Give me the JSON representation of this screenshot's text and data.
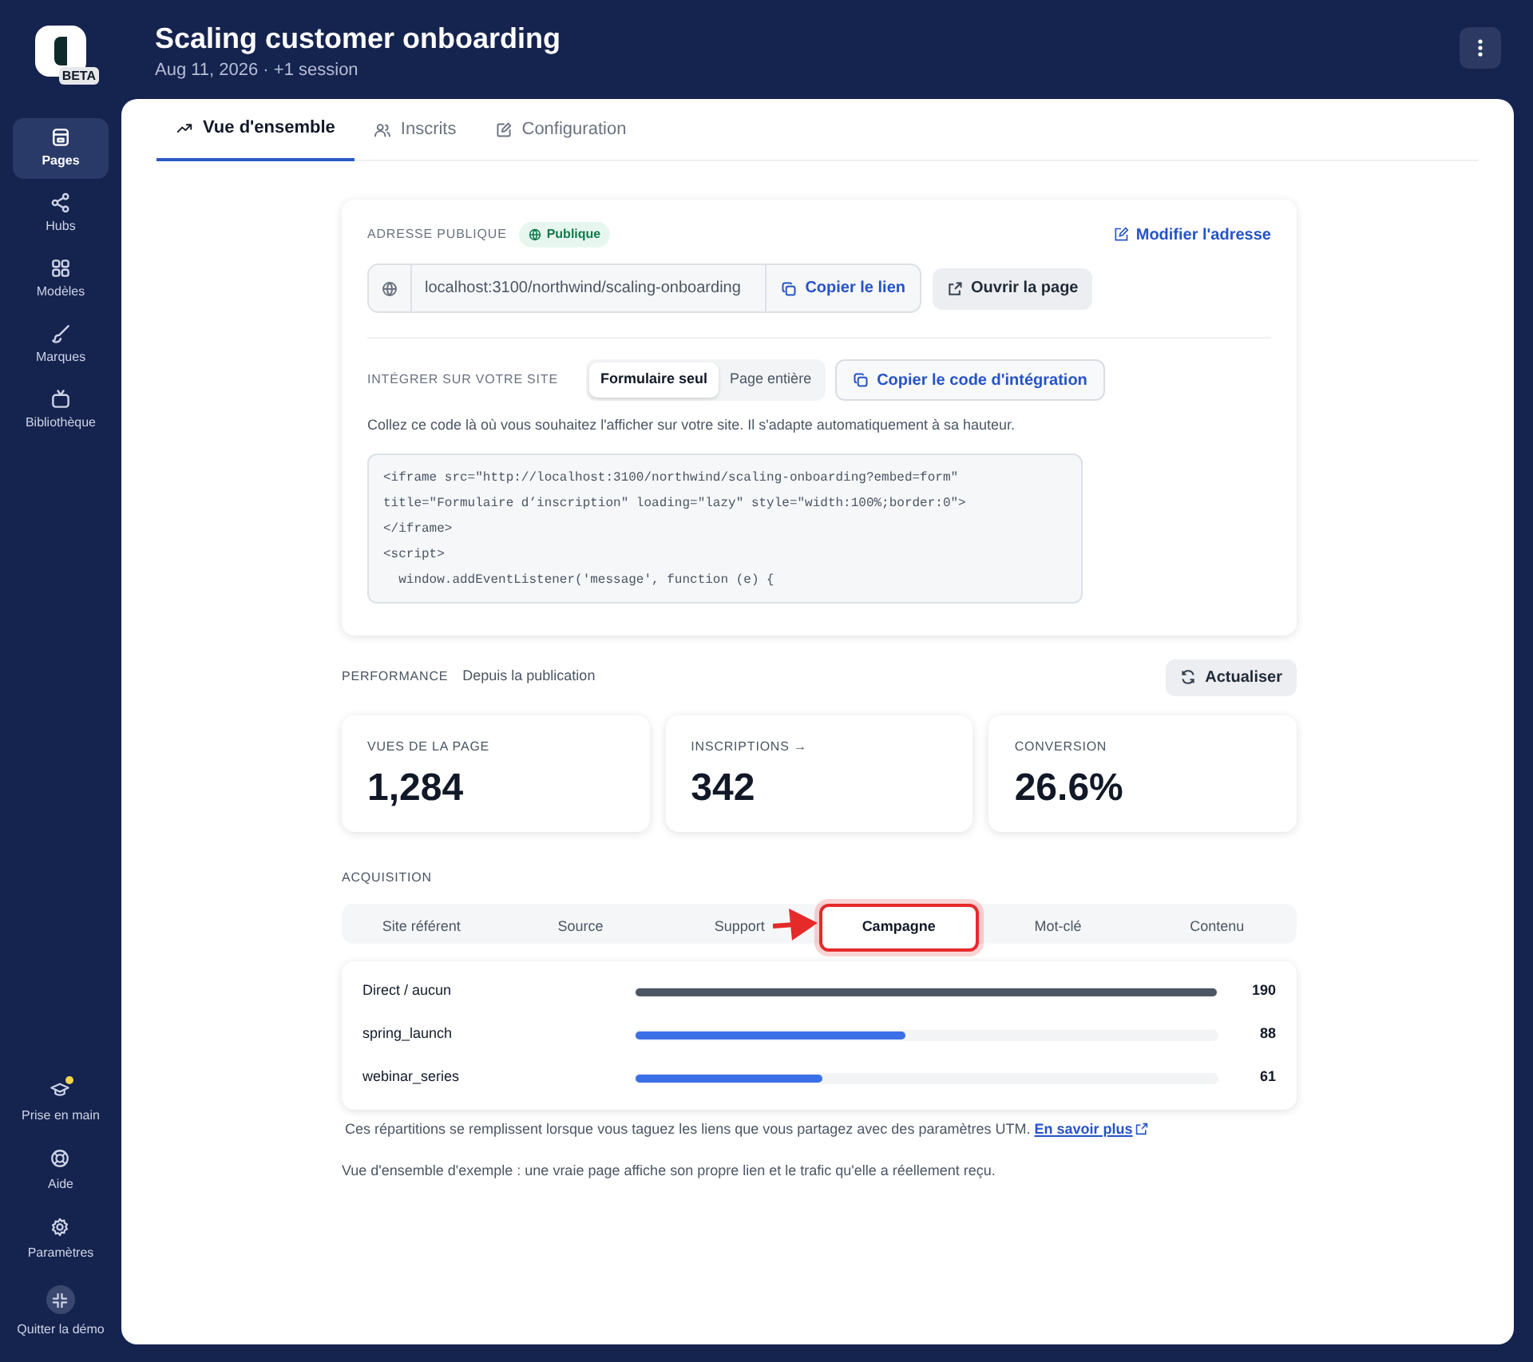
{
  "sidebar": {
    "logo_badge": "BETA",
    "items": [
      {
        "label": "Pages",
        "selected": true
      },
      {
        "label": "Hubs",
        "selected": false
      },
      {
        "label": "Modèles",
        "selected": false
      },
      {
        "label": "Marques",
        "selected": false
      },
      {
        "label": "Bibliothèque",
        "selected": false
      }
    ],
    "bottom_items": [
      {
        "label": "Prise en main",
        "notification": true
      },
      {
        "label": "Aide",
        "notification": false
      },
      {
        "label": "Paramètres",
        "notification": false
      },
      {
        "label": "Quitter la démo",
        "notification": false
      }
    ]
  },
  "header": {
    "title": "Scaling customer onboarding",
    "subtitle": "Aug 11, 2026 · +1 session"
  },
  "tabs": [
    {
      "label": "Vue d'ensemble",
      "selected": true
    },
    {
      "label": "Inscrits",
      "selected": false
    },
    {
      "label": "Configuration",
      "selected": false
    }
  ],
  "public_address": {
    "label": "ADRESSE PUBLIQUE",
    "badge": "Publique",
    "edit_link": "Modifier l'adresse",
    "url": "localhost:3100/northwind/scaling-onboarding",
    "copy_button": "Copier le lien",
    "open_button": "Ouvrir la page"
  },
  "embed": {
    "label": "INTÉGRER SUR VOTRE SITE",
    "modes": [
      {
        "label": "Formulaire seul",
        "selected": true
      },
      {
        "label": "Page entière",
        "selected": false
      }
    ],
    "copy_button": "Copier le code d'intégration",
    "hint": "Collez ce code là où vous souhaitez l'afficher sur votre site. Il s'adapte automatiquement à sa hauteur.",
    "code_lines": [
      "<iframe src=\"http://localhost:3100/northwind/scaling-onboarding?embed=form\"",
      "title=\"Formulaire d’inscription\" loading=\"lazy\" style=\"width:100%;border:0\">",
      "</iframe>",
      "<script>",
      "  window.addEventListener('message', function (e) {"
    ]
  },
  "performance": {
    "label": "PERFORMANCE",
    "period": "Depuis la publication",
    "refresh_button": "Actualiser",
    "stats": [
      {
        "label": "VUES DE LA PAGE",
        "value": "1,284"
      },
      {
        "label": "INSCRIPTIONS →",
        "value": "342"
      },
      {
        "label": "CONVERSION",
        "value": "26.6%"
      }
    ]
  },
  "acquisition": {
    "label": "ACQUISITION",
    "tabs": [
      {
        "label": "Site référent",
        "selected": false
      },
      {
        "label": "Source",
        "selected": false
      },
      {
        "label": "Support",
        "selected": false
      },
      {
        "label": "Campagne",
        "selected": true
      },
      {
        "label": "Mot-clé",
        "selected": false
      },
      {
        "label": "Contenu",
        "selected": false
      }
    ],
    "rows": [
      {
        "name": "Direct / aucun",
        "level": 1,
        "value": "190",
        "color": "#4b5563"
      },
      {
        "name": "spring_launch",
        "level": 0.463,
        "value": "88",
        "color": "#3b6fe8"
      },
      {
        "name": "webinar_series",
        "level": 0.321,
        "value": "61",
        "color": "#3b6fe8"
      }
    ],
    "note": "Ces répartitions se remplissent lorsque vous taguez les liens que vous partagez avec des paramètres UTM.",
    "note_link": "En savoir plus",
    "sample_note": "Vue d'ensemble d'exemple : une vraie page affiche son propre lien et le trafic qu'elle a réellement reçu."
  }
}
